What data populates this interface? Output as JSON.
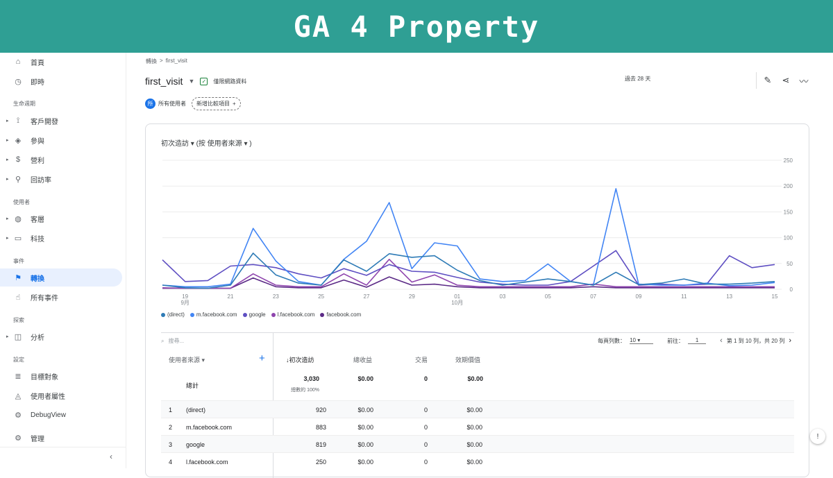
{
  "banner": {
    "title": "GA 4 Property"
  },
  "sidebar": {
    "items": [
      {
        "icon": "home-icon",
        "glyph": "⌂",
        "label": "首頁"
      },
      {
        "icon": "clock-icon",
        "glyph": "◷",
        "label": "即時"
      }
    ],
    "section_lifecycle": "生命週期",
    "lifecycle": [
      {
        "icon": "acquisition-icon",
        "glyph": "⟟",
        "label": "客戶開發"
      },
      {
        "icon": "tag-icon",
        "glyph": "◈",
        "label": "參與"
      },
      {
        "icon": "dollar-icon",
        "glyph": "$",
        "label": "營利"
      },
      {
        "icon": "retention-icon",
        "glyph": "⚲",
        "label": "回訪率"
      }
    ],
    "section_user": "使用者",
    "user": [
      {
        "icon": "globe-icon",
        "glyph": "◍",
        "label": "客層"
      },
      {
        "icon": "devices-icon",
        "glyph": "▭",
        "label": "科技"
      }
    ],
    "section_events": "事件",
    "events": [
      {
        "icon": "flag-icon",
        "glyph": "⚑",
        "label": "轉換"
      },
      {
        "icon": "touch-icon",
        "glyph": "☝",
        "label": "所有事件"
      }
    ],
    "section_explore": "探索",
    "explore": [
      {
        "icon": "analysis-icon",
        "glyph": "◫",
        "label": "分析"
      }
    ],
    "section_config": "設定",
    "config": [
      {
        "icon": "audience-icon",
        "glyph": "≣",
        "label": "目標對象"
      },
      {
        "icon": "user-property-icon",
        "glyph": "◬",
        "label": "使用者屬性"
      },
      {
        "icon": "debug-icon",
        "glyph": "⚙",
        "label": "DebugView"
      }
    ],
    "admin": {
      "icon": "gear-icon",
      "glyph": "⚙",
      "label": "管理"
    },
    "collapse_glyph": "‹"
  },
  "header": {
    "breadcrumb_parent": "轉換",
    "breadcrumb_sep": ">",
    "breadcrumb_current": "first_visit",
    "event_name": "first_visit",
    "dropdown_glyph": "▼",
    "check_glyph": "✓",
    "data_filter": "僅限網路資料",
    "period": "過去 28 天",
    "tools": [
      {
        "icon": "edit-report-icon",
        "glyph": "✎"
      },
      {
        "icon": "share-icon",
        "glyph": "⋖"
      },
      {
        "icon": "insights-icon",
        "glyph": "〰"
      }
    ],
    "segment_avatar": "所",
    "segment_label": "所有使用者",
    "add_compare": "新增比較項目",
    "add_glyph": "+"
  },
  "chart_title": "初次造訪 ▾ (按 使用者來源 ▾ )",
  "chart_data": {
    "type": "line",
    "x": [
      "9/18",
      "9/19",
      "9/20",
      "9/21",
      "9/22",
      "9/23",
      "9/24",
      "9/25",
      "9/26",
      "9/27",
      "9/28",
      "9/29",
      "9/30",
      "10/01",
      "10/02",
      "10/03",
      "10/04",
      "10/05",
      "10/06",
      "10/07",
      "10/08",
      "10/09",
      "10/10",
      "10/11",
      "10/12",
      "10/13",
      "10/14",
      "10/15"
    ],
    "x_tick_labels": [
      "19",
      "21",
      "23",
      "25",
      "27",
      "29",
      "01",
      "03",
      "05",
      "07",
      "09",
      "11",
      "13",
      "15"
    ],
    "x_month_labels": [
      "9月",
      "10月"
    ],
    "y_tick_labels": [
      "250",
      "200",
      "150",
      "100",
      "50",
      "0"
    ],
    "ylim": [
      0,
      250
    ],
    "series": [
      {
        "name": "(direct)",
        "color": "#2e7bb6",
        "values": [
          8,
          3,
          2,
          8,
          70,
          28,
          12,
          8,
          57,
          35,
          69,
          62,
          65,
          37,
          17,
          8,
          14,
          20,
          15,
          8,
          33,
          9,
          12,
          20,
          10,
          10,
          12,
          15
        ]
      },
      {
        "name": "m.facebook.com",
        "color": "#4285f4",
        "values": [
          8,
          5,
          5,
          10,
          118,
          55,
          15,
          8,
          58,
          93,
          168,
          40,
          90,
          84,
          20,
          15,
          17,
          49,
          15,
          8,
          195,
          10,
          8,
          8,
          12,
          7,
          8,
          13
        ]
      },
      {
        "name": "google",
        "color": "#5e4ec2",
        "values": [
          57,
          15,
          17,
          45,
          48,
          42,
          30,
          22,
          40,
          27,
          48,
          35,
          33,
          23,
          14,
          10,
          8,
          8,
          15,
          45,
          75,
          8,
          10,
          8,
          10,
          65,
          42,
          48
        ]
      },
      {
        "name": "l.facebook.com",
        "color": "#8e44ad",
        "values": [
          3,
          2,
          2,
          2,
          30,
          8,
          5,
          5,
          30,
          8,
          58,
          14,
          28,
          8,
          5,
          5,
          5,
          5,
          5,
          10,
          5,
          5,
          5,
          5,
          5,
          5,
          5,
          5
        ]
      },
      {
        "name": "facebook.com",
        "color": "#5b2a86",
        "values": [
          2,
          2,
          2,
          2,
          22,
          5,
          3,
          3,
          18,
          4,
          24,
          8,
          10,
          5,
          3,
          3,
          3,
          3,
          3,
          5,
          3,
          3,
          3,
          3,
          3,
          3,
          3,
          3
        ]
      }
    ]
  },
  "table": {
    "search_placeholder": "搜尋...",
    "search_glyph": "⌕",
    "rows_per_page_label": "每頁列數：",
    "rows_per_page": "10",
    "goto_label": "前往：",
    "goto_value": "1",
    "range": "第 1 到 10 列，共 20 列",
    "prev_glyph": "‹",
    "next_glyph": "›",
    "dim_header": "使用者來源 ▾",
    "add_glyph": "+",
    "headers": [
      "↓初次造訪",
      "總收益",
      "交易",
      "效期價值"
    ],
    "total_label": "總計",
    "totals": [
      "3,030",
      "$0.00",
      "0",
      "$0.00"
    ],
    "totals_sub": "總數的 100%",
    "rows": [
      {
        "idx": "1",
        "name": "(direct)",
        "vals": [
          "920",
          "$0.00",
          "0",
          "$0.00"
        ]
      },
      {
        "idx": "2",
        "name": "m.facebook.com",
        "vals": [
          "883",
          "$0.00",
          "0",
          "$0.00"
        ]
      },
      {
        "idx": "3",
        "name": "google",
        "vals": [
          "819",
          "$0.00",
          "0",
          "$0.00"
        ]
      },
      {
        "idx": "4",
        "name": "l.facebook.com",
        "vals": [
          "250",
          "$0.00",
          "0",
          "$0.00"
        ]
      }
    ]
  },
  "feedback_glyph": "!"
}
